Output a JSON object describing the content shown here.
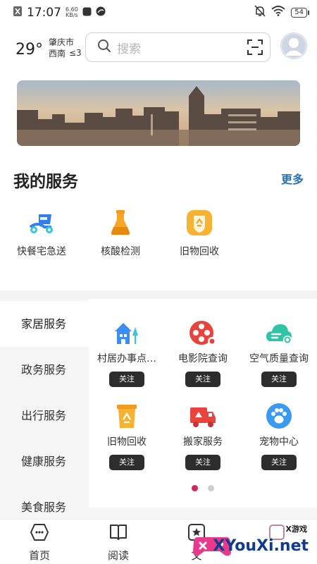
{
  "status_bar": {
    "time": "17:07",
    "net_speed_value": "6.60",
    "net_speed_unit": "KB/s",
    "battery": "54"
  },
  "weather": {
    "temperature": "29°",
    "city": "肇庆市",
    "wind": "西南",
    "aqi": "≤3"
  },
  "search": {
    "placeholder": "搜索"
  },
  "my_services": {
    "title": "我的服务",
    "more": "更多",
    "items": [
      {
        "label": "快餐宅急送",
        "icon": "delivery-scooter-icon"
      },
      {
        "label": "核酸检测",
        "icon": "test-flask-icon"
      },
      {
        "label": "旧物回收",
        "icon": "recycle-badge-icon"
      }
    ]
  },
  "categories": [
    {
      "label": "家居服务",
      "active": true
    },
    {
      "label": "政务服务",
      "active": false
    },
    {
      "label": "出行服务",
      "active": false
    },
    {
      "label": "健康服务",
      "active": false
    },
    {
      "label": "美食服务",
      "active": false
    }
  ],
  "services": [
    {
      "label": "村居办事点…",
      "icon": "village-office-icon",
      "follow": "关注"
    },
    {
      "label": "电影院查询",
      "icon": "film-reel-icon",
      "follow": "关注"
    },
    {
      "label": "空气质量查询",
      "icon": "air-quality-icon",
      "follow": "关注"
    },
    {
      "label": "旧物回收",
      "icon": "recycle-bin-icon",
      "follow": "关注"
    },
    {
      "label": "搬家服务",
      "icon": "moving-truck-icon",
      "follow": "关注"
    },
    {
      "label": "宠物中心",
      "icon": "pet-paw-icon",
      "follow": "关注"
    }
  ],
  "pager": {
    "current": 1,
    "total": 2
  },
  "bottom_nav": [
    {
      "label": "首页",
      "icon": "home-icon"
    },
    {
      "label": "阅读",
      "icon": "book-icon"
    },
    {
      "label": "文",
      "icon": "star-doc-icon"
    }
  ],
  "watermark": {
    "small": "X游戏",
    "big": "XYouXi.net"
  },
  "colors": {
    "accent_blue": "#2a6fb0",
    "pager_active": "#d6245c",
    "follow_button": "#2d2d2d",
    "watermark_blue": "#0d3d8c"
  }
}
